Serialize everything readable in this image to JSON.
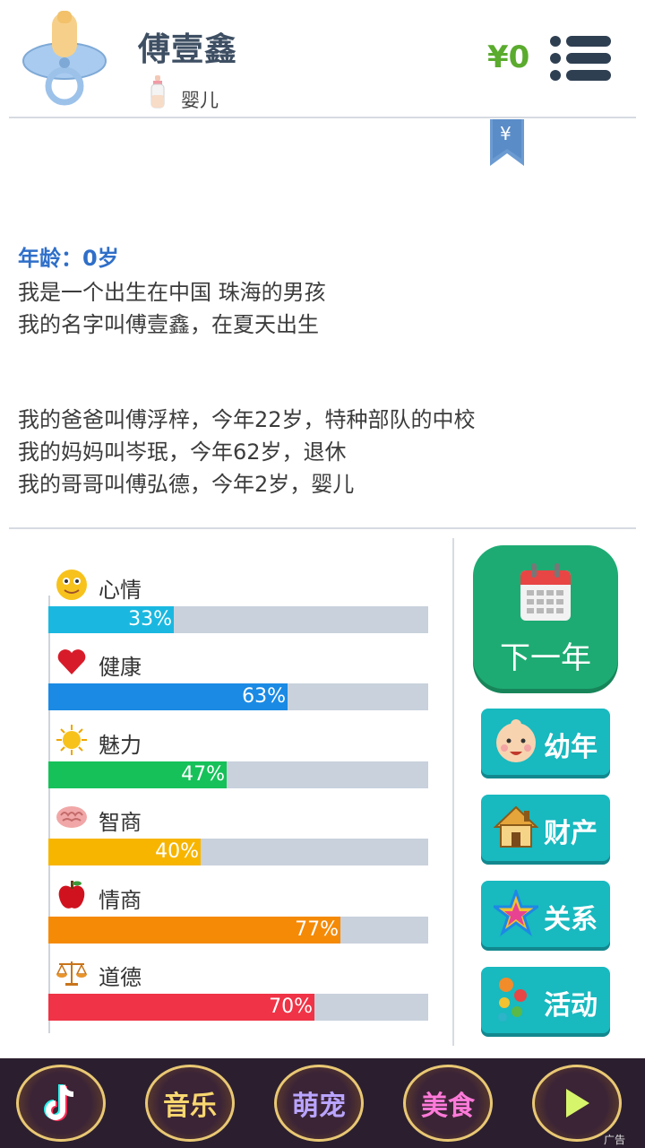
{
  "header": {
    "name": "傅壹鑫",
    "stage": "婴儿",
    "money": "¥0",
    "bookmark_symbol": "¥"
  },
  "story": {
    "age": "年龄：0岁",
    "lines": [
      "我是一个出生在中国 珠海的男孩",
      "我的名字叫傅壹鑫，在夏天出生",
      "我的爸爸叫傅浮梓，今年22岁，特种部队的中校",
      "我的妈妈叫岑珉，今年62岁，退休",
      "我的哥哥叫傅弘德，今年2岁，婴儿"
    ]
  },
  "stats": [
    {
      "label": "心情",
      "value": 33,
      "text": "33%",
      "color": "#1ab8e0",
      "icon": "smiley-icon"
    },
    {
      "label": "健康",
      "value": 63,
      "text": "63%",
      "color": "#1a8ae4",
      "icon": "heart-icon"
    },
    {
      "label": "魅力",
      "value": 47,
      "text": "47%",
      "color": "#16c15a",
      "icon": "sun-icon"
    },
    {
      "label": "智商",
      "value": 40,
      "text": "40%",
      "color": "#f7b500",
      "icon": "brain-icon"
    },
    {
      "label": "情商",
      "value": 77,
      "text": "77%",
      "color": "#f58a07",
      "icon": "apple-icon"
    },
    {
      "label": "道德",
      "value": 70,
      "text": "70%",
      "color": "#f03346",
      "icon": "scales-icon"
    }
  ],
  "actions": {
    "next_year": "下一年",
    "childhood": "幼年",
    "property": "财产",
    "relations": "关系",
    "activities": "活动"
  },
  "ads": {
    "items": [
      "音乐",
      "萌宠",
      "美食"
    ],
    "tag": "广告"
  }
}
